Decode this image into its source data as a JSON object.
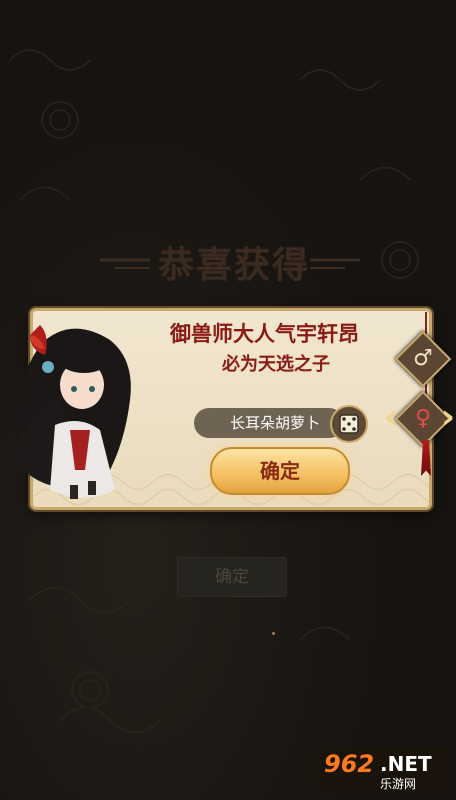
{
  "banner": {
    "title": "恭喜获得"
  },
  "dialog": {
    "heading_line1": "御兽师大人气宇轩昂",
    "heading_line2": "必为天选之子",
    "random_name": "长耳朵胡萝卜",
    "confirm_label": "确定",
    "selected_gender": "female"
  },
  "gender": {
    "male_symbol": "♂",
    "female_symbol": "♀"
  },
  "background": {
    "confirm_label": "确定"
  },
  "watermark": {
    "number": "962",
    "suffix": ".NET",
    "subtitle": "乐游网"
  },
  "colors": {
    "heading": "#8a1a14",
    "button": "#f3c061",
    "pill": "#6f6353"
  },
  "icons": [
    "dice-icon",
    "male-icon",
    "female-icon",
    "chevron-left-icon",
    "chevron-right-icon"
  ]
}
